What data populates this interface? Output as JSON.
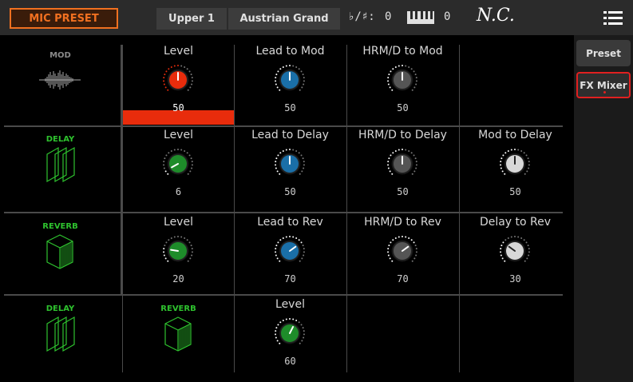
{
  "topbar": {
    "mic_preset": "MIC PRESET",
    "part": "Upper 1",
    "sound": "Austrian Grand",
    "transpose_label": "♭/♯:",
    "transpose_value": "0",
    "octave_value": "0",
    "chord": "N.C."
  },
  "side": {
    "preset": "Preset",
    "fx_mixer": "FX Mixer"
  },
  "rows": [
    {
      "fx": "MOD",
      "knobs": [
        {
          "label": "Level",
          "value": "50",
          "color": "#e82c0c"
        },
        {
          "label": "Lead to Mod",
          "value": "50",
          "color": "#1a6fa8"
        },
        {
          "label": "HRM/D to Mod",
          "value": "50",
          "color": "#555555"
        }
      ]
    },
    {
      "fx": "DELAY",
      "knobs": [
        {
          "label": "Level",
          "value": "6",
          "color": "#1e8c2a"
        },
        {
          "label": "Lead to Delay",
          "value": "50",
          "color": "#1a6fa8"
        },
        {
          "label": "HRM/D to Delay",
          "value": "50",
          "color": "#555555"
        },
        {
          "label": "Mod to Delay",
          "value": "50",
          "color": "#d8d8d8"
        }
      ]
    },
    {
      "fx": "REVERB",
      "knobs": [
        {
          "label": "Level",
          "value": "20",
          "color": "#1e8c2a"
        },
        {
          "label": "Lead to Rev",
          "value": "70",
          "color": "#1a6fa8"
        },
        {
          "label": "HRM/D to Rev",
          "value": "70",
          "color": "#555555"
        },
        {
          "label": "Delay to Rev",
          "value": "30",
          "color": "#d8d8d8"
        }
      ]
    },
    {
      "fx": "DELAY",
      "fx2": "REVERB",
      "knobs": [
        {
          "label": "Level",
          "value": "60",
          "color": "#1e8c2a"
        }
      ]
    }
  ]
}
